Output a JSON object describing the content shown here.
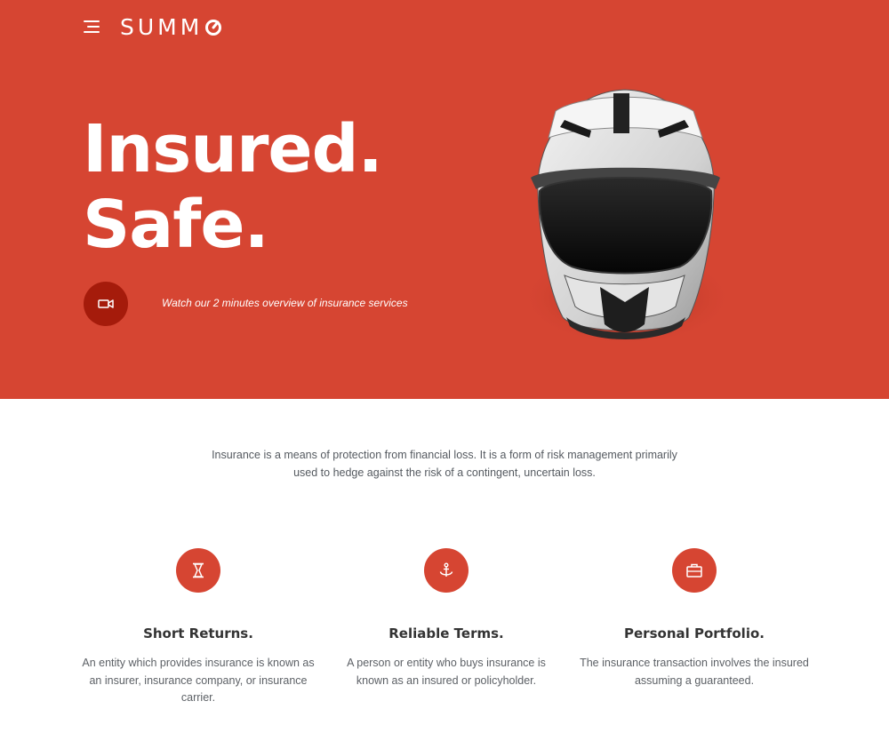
{
  "header": {
    "menu_icon": "hamburger-menu-icon",
    "logo": "SUMM"
  },
  "hero": {
    "headline_line1": "Insured.",
    "headline_line2": "Safe.",
    "video_icon": "video-camera-icon",
    "video_text": "Watch our 2 minutes overview of insurance services",
    "background_color": "#d64532",
    "accent_dark": "#a51b0b"
  },
  "intro": {
    "text_line1": "Insurance is a means of protection from financial loss. It is a form of risk management primarily",
    "text_line2": "used to hedge against the risk of a contingent, uncertain loss."
  },
  "features": [
    {
      "icon": "hourglass-icon",
      "title": "Short Returns.",
      "text": "An entity which provides insurance is known as an insurer, insurance company, or insurance carrier."
    },
    {
      "icon": "anchor-icon",
      "title": "Reliable Terms.",
      "text": "A person or entity who buys insurance is known as an insured or policyholder."
    },
    {
      "icon": "briefcase-icon",
      "title": "Personal Portfolio.",
      "text": "The insurance transaction involves the insured assuming a guaranteed."
    }
  ]
}
